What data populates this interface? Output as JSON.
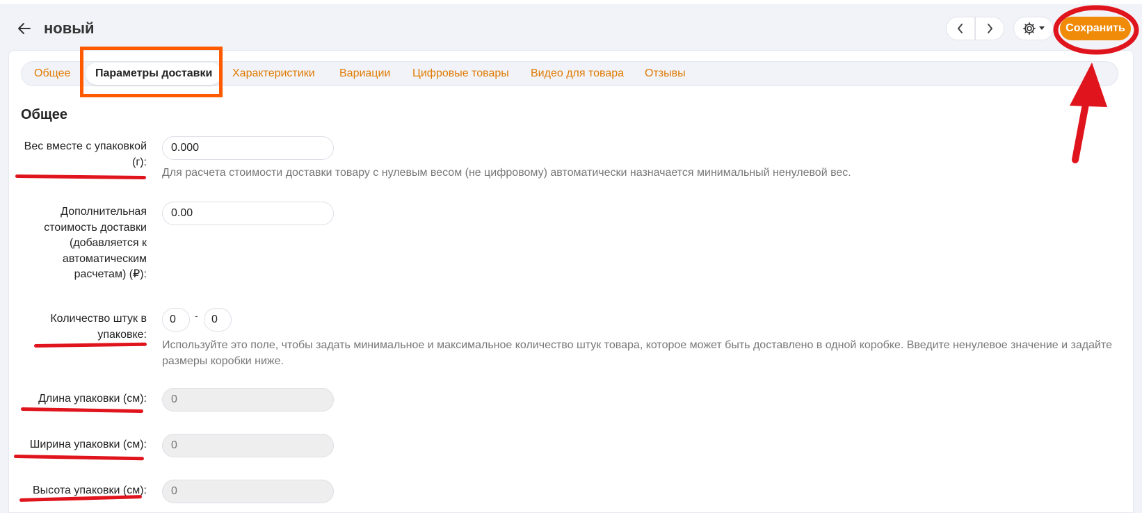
{
  "header": {
    "title": "новый",
    "save_label": "Сохранить"
  },
  "icons": {
    "back": "arrow-left-icon",
    "prev": "chevron-left-icon",
    "next": "chevron-right-icon",
    "settings": "gear-icon",
    "dropdown": "caret-down-icon"
  },
  "tabs": [
    {
      "label": "Общее",
      "active": false
    },
    {
      "label": "Параметры доставки",
      "active": true
    },
    {
      "label": "Характеристики",
      "active": false
    },
    {
      "label": "Вариации",
      "active": false
    },
    {
      "label": "Цифровые товары",
      "active": false
    },
    {
      "label": "Видео для товара",
      "active": false
    },
    {
      "label": "Отзывы",
      "active": false
    }
  ],
  "section": {
    "title": "Общее"
  },
  "fields": {
    "weight": {
      "label": "Вес вместе с упаковкой (г):",
      "value": "0.000",
      "hint": "Для расчета стоимости доставки товару с нулевым весом (не цифровому) автоматически назначается минимальный ненулевой вес."
    },
    "extra_cost": {
      "label": "Дополнительная стоимость доставки (добавляется к автоматическим расчетам) (₽):",
      "value": "0.00"
    },
    "qty": {
      "label": "Количество штук в упаковке:",
      "min": "0",
      "max": "0",
      "separator": "-",
      "hint": "Используйте это поле, чтобы задать минимальное и максимальное количество штук товара, которое может быть доставлено в одной коробке. Введите ненулевое значение и задайте размеры коробки ниже."
    },
    "length": {
      "label": "Длина упаковки (см):",
      "placeholder": "0"
    },
    "width": {
      "label": "Ширина упаковки (см):",
      "placeholder": "0"
    },
    "height": {
      "label": "Высота упаковки (см):",
      "placeholder": "0"
    }
  },
  "colors": {
    "accent": "#f08a09",
    "tab_link": "#e07a00",
    "annotation_red": "#e0141c",
    "annotation_orange": "#ff5a00"
  }
}
